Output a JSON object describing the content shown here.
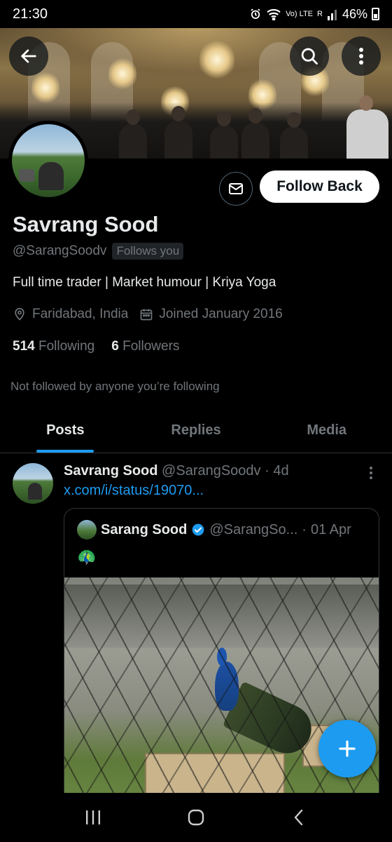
{
  "status_bar": {
    "time": "21:30",
    "network_label": "Vo) LTE",
    "carrier_label": "R",
    "battery_percent": "46%"
  },
  "header": {
    "back_icon": "arrow-left-icon",
    "search_icon": "search-icon",
    "more_icon": "more-vertical-icon"
  },
  "profile": {
    "name": "Savrang Sood",
    "handle": "@SarangSoodv",
    "follows_you_badge": "Follows you",
    "bio": "Full time trader | Market humour | Kriya Yoga",
    "location": "Faridabad, India",
    "joined": "Joined January 2016",
    "following_count": "514",
    "following_label": "Following",
    "followers_count": "6",
    "followers_label": "Followers",
    "not_followed_text": "Not followed by anyone you’re following",
    "follow_button_label": "Follow Back",
    "message_icon": "mail-icon"
  },
  "tabs": [
    {
      "label": "Posts",
      "active": true
    },
    {
      "label": "Replies",
      "active": false
    },
    {
      "label": "Media",
      "active": false
    }
  ],
  "post": {
    "author_name": "Savrang Sood",
    "author_handle": "@SarangSoodv",
    "separator": "·",
    "time": "4d",
    "link_text": "x.com/i/status/19070...",
    "quote": {
      "author_name": "Sarang Sood",
      "author_handle": "@SarangSo...",
      "separator": "·",
      "date": "01 Apr",
      "emoji": "🦚",
      "verified": true
    }
  },
  "fab": {
    "icon": "plus-icon"
  },
  "nav_bar": {
    "recents_icon": "recents-icon",
    "home_icon": "home-icon",
    "back_icon": "back-chevron-icon"
  },
  "colors": {
    "accent": "#1d9bf0",
    "background": "#000000",
    "text_primary": "#e7e9ea",
    "text_secondary": "#71767b"
  }
}
